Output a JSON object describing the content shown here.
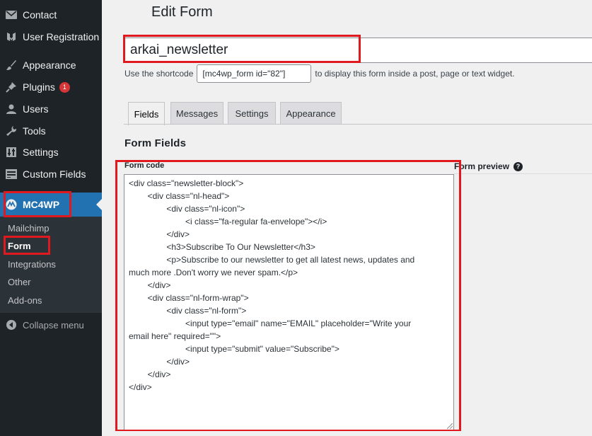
{
  "sidebar": {
    "items": [
      {
        "label": "Contact",
        "icon": "mail-icon"
      },
      {
        "label": "User Registration",
        "icon": "user-registration-icon"
      },
      {
        "label": "Appearance",
        "icon": "paintbrush-icon"
      },
      {
        "label": "Plugins",
        "icon": "plugin-icon",
        "badge": "1"
      },
      {
        "label": "Users",
        "icon": "users-icon"
      },
      {
        "label": "Tools",
        "icon": "wrench-icon"
      },
      {
        "label": "Settings",
        "icon": "settings-icon"
      },
      {
        "label": "Custom Fields",
        "icon": "custom-fields-icon"
      }
    ],
    "active": {
      "label": "MC4WP",
      "icon": "mc4wp-icon"
    },
    "submenu": [
      "Mailchimp",
      "Form",
      "Integrations",
      "Other",
      "Add-ons"
    ],
    "submenu_current": "Form",
    "collapse_label": "Collapse menu"
  },
  "main": {
    "page_title": "Edit Form",
    "form_name": "arkai_newsletter",
    "shortcode_prefix": "Use the shortcode",
    "shortcode_value": "[mc4wp_form id=\"82\"]",
    "shortcode_suffix": "to display this form inside a post, page or text widget.",
    "tabs": [
      "Fields",
      "Messages",
      "Settings",
      "Appearance"
    ],
    "active_tab": "Fields",
    "section_title": "Form Fields",
    "form_code_label": "Form code",
    "form_preview_label": "Form preview",
    "help_symbol": "?",
    "code_lines": [
      "<div class=\"newsletter-block\">",
      "        <div class=\"nl-head\">",
      "                <div class=\"nl-icon\">",
      "                        <i class=\"fa-regular fa-envelope\"></i>",
      "                </div>",
      "                <h3>Subscribe To Our Newsletter</h3>",
      "                <p>Subscribe to our newsletter to get all latest news, updates and",
      "much more .Don't worry we never spam.</p>",
      "        </div>",
      "        <div class=\"nl-form-wrap\">",
      "                <div class=\"nl-form\">",
      "                        <input type=\"email\" name=\"EMAIL\" placeholder=\"Write your",
      "email here\" required=\"\">",
      "                        <input type=\"submit\" value=\"Subscribe\">",
      "                </div>",
      "        </div>",
      "</div>"
    ]
  },
  "colors": {
    "sidebar_bg": "#1d2327",
    "active_bg": "#2271b1",
    "highlight_border": "#e0191e",
    "badge": "#d63638"
  }
}
